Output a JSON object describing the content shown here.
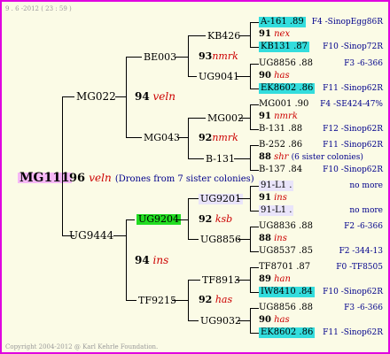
{
  "header": {
    "date": "9 .  6 -2012 ( 23 : 59 )"
  },
  "footer": {
    "copyright": "Copyright 2004-2012 @ Karl Kehrle Foundation."
  },
  "root": {
    "id": "MG111",
    "num": "96",
    "queen": "veln",
    "note": "(Drones from 7 sister colonies)"
  },
  "gen1": {
    "top": "MG022",
    "bottom": "UG9444"
  },
  "gen2": {
    "mg022": {
      "num": "94",
      "queen": "veln"
    },
    "ug9444": {
      "num": "94",
      "queen": "ins"
    },
    "be003": "BE003",
    "mg043": "MG043",
    "ug9204": "UG9204",
    "tf9215": "TF9215"
  },
  "gen3": {
    "be003": {
      "num": "93",
      "queen": "nmrk"
    },
    "mg043": {
      "num": "92",
      "queen": "nmrk"
    },
    "ug9204": {
      "num": "92",
      "queen": "ksb"
    },
    "tf9215": {
      "num": "92",
      "queen": "has"
    },
    "kb426": "KB426",
    "ug9041": "UG9041",
    "mg002": "MG002",
    "b131": "B-131",
    "ug9201": "UG9201",
    "ug8856": "UG8856",
    "tf8913": "TF8913",
    "ug9032": "UG9032"
  },
  "gen4": [
    {
      "sire": "A-161 .89",
      "num": "91",
      "queen": "nex",
      "dam": "KB131 .87",
      "sire_right": "F4 -SinopEgg86R",
      "dam_right": "F10 -Sinop72R"
    },
    {
      "sire": "UG8856 .88",
      "num": "90",
      "queen": "has",
      "dam": "EK8602 .86",
      "sire_right": "F3 -6-366",
      "dam_right": "F11 -Sinop62R"
    },
    {
      "sire": "MG001 .90",
      "num": "91",
      "queen": "nmrk",
      "dam": "B-131 .88",
      "sire_right": "F4 -SE424-47%",
      "dam_right": "F12 -Sinop62R"
    },
    {
      "sire": "B-252 .86",
      "num": "88",
      "queen": "shr",
      "note": "(6 sister colonies)",
      "dam": "B-137 .84",
      "sire_right": "F11 -Sinop62R",
      "dam_right": "F10 -Sinop62R"
    },
    {
      "sire": "91-L1 .",
      "num": "91",
      "queen": "ins",
      "dam": "91-L1 .",
      "sire_right": "no more",
      "dam_right": "no more"
    },
    {
      "sire": "UG8836 .88",
      "num": "88",
      "queen": "ins",
      "dam": "UG8537 .85",
      "sire_right": "F2 -6-366",
      "dam_right": "F2 -344-13"
    },
    {
      "sire": "TF8701 .87",
      "num": "89",
      "queen": "han",
      "dam": "IW8410 .84",
      "sire_right": "F0 -TF8505",
      "dam_right": "F10 -Sinop62R"
    },
    {
      "sire": "UG8856 .88",
      "num": "90",
      "queen": "has",
      "dam": "EK8602 .86",
      "sire_right": "F3 -6-366",
      "dam_right": "F11 -Sinop62R"
    }
  ],
  "colors": {
    "border": "#e000e0",
    "cyan": "#33dddd",
    "green": "#22dd22",
    "queen_red": "#cc0000",
    "right_blue": "#00008b"
  }
}
